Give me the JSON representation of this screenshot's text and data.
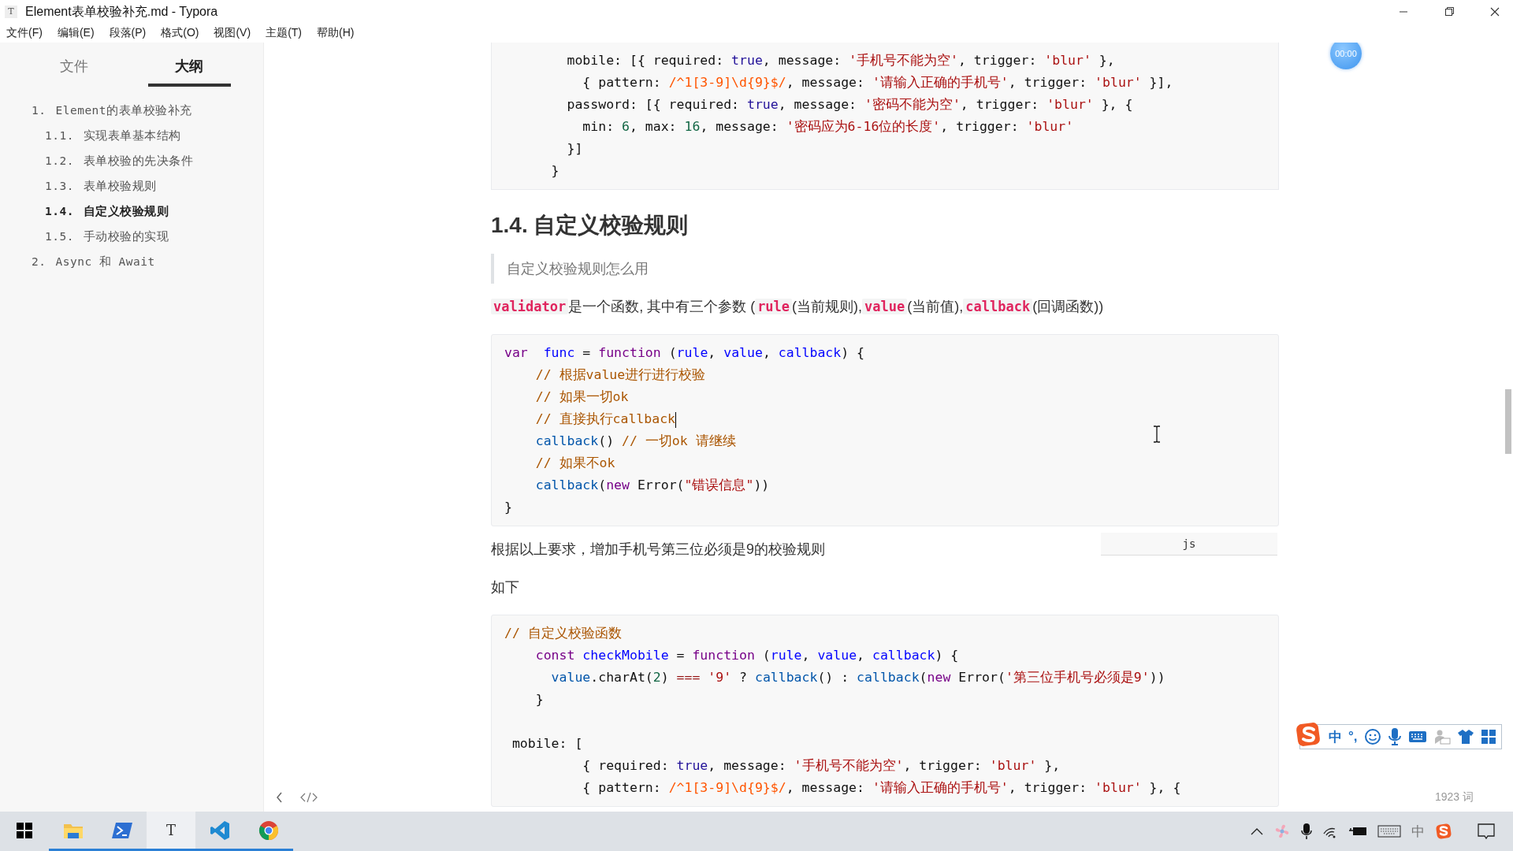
{
  "window": {
    "icon_letter": "T",
    "title": "Element表单校验补充.md - Typora"
  },
  "menu": [
    "文件(F)",
    "编辑(E)",
    "段落(P)",
    "格式(O)",
    "视图(V)",
    "主题(T)",
    "帮助(H)"
  ],
  "sidebar": {
    "tabs": [
      {
        "label": "文件",
        "selected": false
      },
      {
        "label": "大纲",
        "selected": true
      }
    ],
    "outline": [
      {
        "number": "1.",
        "label": "Element的表单校验补充",
        "selected": false,
        "children": [
          {
            "number": "1.1.",
            "label": "实现表单基本结构",
            "selected": false
          },
          {
            "number": "1.2.",
            "label": "表单校验的先决条件",
            "selected": false
          },
          {
            "number": "1.3.",
            "label": "表单校验规则",
            "selected": false
          },
          {
            "number": "1.4.",
            "label": "自定义校验规则",
            "selected": true
          },
          {
            "number": "1.5.",
            "label": "手动校验的实现",
            "selected": false
          }
        ]
      },
      {
        "number": "2.",
        "label": "Async 和 Await",
        "selected": false
      }
    ]
  },
  "document": {
    "blocks": [
      {
        "kind": "code",
        "lines": [
          {
            "tokens": [
              {
                "kind": "plain",
                "text": "        mobile: [{ required: "
              },
              {
                "kind": "atom",
                "text": "true"
              },
              {
                "kind": "plain",
                "text": ", message: "
              },
              {
                "kind": "string",
                "text": "'手机号不能为空'"
              },
              {
                "kind": "plain",
                "text": ", trigger: "
              },
              {
                "kind": "string",
                "text": "'blur'"
              },
              {
                "kind": "plain",
                "text": " },"
              }
            ]
          },
          {
            "tokens": [
              {
                "kind": "plain",
                "text": "          { pattern: "
              },
              {
                "kind": "regex",
                "text": "/^1[3-9]\\d{9}$/"
              },
              {
                "kind": "plain",
                "text": ", message: "
              },
              {
                "kind": "string",
                "text": "'请输入正确的手机号'"
              },
              {
                "kind": "plain",
                "text": ", trigger: "
              },
              {
                "kind": "string",
                "text": "'blur'"
              },
              {
                "kind": "plain",
                "text": " }],"
              }
            ]
          },
          {
            "tokens": [
              {
                "kind": "plain",
                "text": "        password: [{ required: "
              },
              {
                "kind": "atom",
                "text": "true"
              },
              {
                "kind": "plain",
                "text": ", message: "
              },
              {
                "kind": "string",
                "text": "'密码不能为空'"
              },
              {
                "kind": "plain",
                "text": ", trigger: "
              },
              {
                "kind": "string",
                "text": "'blur'"
              },
              {
                "kind": "plain",
                "text": " }, {"
              }
            ]
          },
          {
            "tokens": [
              {
                "kind": "plain",
                "text": "          min: "
              },
              {
                "kind": "number",
                "text": "6"
              },
              {
                "kind": "plain",
                "text": ", max: "
              },
              {
                "kind": "number",
                "text": "16"
              },
              {
                "kind": "plain",
                "text": ", message: "
              },
              {
                "kind": "string",
                "text": "'密码应为6-16位的长度'"
              },
              {
                "kind": "plain",
                "text": ", trigger: "
              },
              {
                "kind": "string",
                "text": "'blur'"
              }
            ]
          },
          {
            "tokens": [
              {
                "kind": "plain",
                "text": "        }]"
              }
            ]
          },
          {
            "tokens": [
              {
                "kind": "plain",
                "text": "      }"
              }
            ]
          }
        ]
      },
      {
        "kind": "heading",
        "text": "1.4. 自定义校验规则"
      },
      {
        "kind": "quote",
        "text": "自定义校验规则怎么用"
      },
      {
        "kind": "paragraph",
        "parts": [
          {
            "kind": "code",
            "text": "validator"
          },
          {
            "kind": "text",
            "text": "是一个函数, 其中有三个参数 ("
          },
          {
            "kind": "code",
            "text": "rule"
          },
          {
            "kind": "text",
            "text": "(当前规则),"
          },
          {
            "kind": "code",
            "text": "value"
          },
          {
            "kind": "text",
            "text": "(当前值),"
          },
          {
            "kind": "code",
            "text": "callback"
          },
          {
            "kind": "text",
            "text": "(回调函数))"
          }
        ]
      },
      {
        "kind": "code",
        "language": "js",
        "lines": [
          {
            "caret": false,
            "tokens": [
              {
                "kind": "keyword",
                "text": "var  "
              },
              {
                "kind": "def",
                "text": "func"
              },
              {
                "kind": "plain",
                "text": " = "
              },
              {
                "kind": "keyword",
                "text": "function"
              },
              {
                "kind": "plain",
                "text": " ("
              },
              {
                "kind": "def",
                "text": "rule"
              },
              {
                "kind": "plain",
                "text": ", "
              },
              {
                "kind": "def",
                "text": "value"
              },
              {
                "kind": "plain",
                "text": ", "
              },
              {
                "kind": "def",
                "text": "callback"
              },
              {
                "kind": "plain",
                "text": ") {"
              }
            ]
          },
          {
            "caret": false,
            "tokens": [
              {
                "kind": "comment",
                "text": "    // 根据value进行进行校验"
              }
            ]
          },
          {
            "caret": false,
            "tokens": [
              {
                "kind": "comment",
                "text": "    // 如果一切ok"
              }
            ]
          },
          {
            "caret": true,
            "tokens": [
              {
                "kind": "comment",
                "text": "    // 直接执行callback"
              }
            ]
          },
          {
            "caret": false,
            "tokens": [
              {
                "kind": "variable",
                "text": "    callback"
              },
              {
                "kind": "plain",
                "text": "() "
              },
              {
                "kind": "comment",
                "text": "// 一切ok 请继续"
              }
            ]
          },
          {
            "caret": false,
            "tokens": [
              {
                "kind": "comment",
                "text": "    // 如果不ok"
              }
            ]
          },
          {
            "caret": false,
            "tokens": [
              {
                "kind": "variable",
                "text": "    callback"
              },
              {
                "kind": "plain",
                "text": "("
              },
              {
                "kind": "keyword",
                "text": "new"
              },
              {
                "kind": "plain",
                "text": " Error("
              },
              {
                "kind": "string",
                "text": "\"错误信息\""
              },
              {
                "kind": "plain",
                "text": "))"
              }
            ]
          },
          {
            "caret": false,
            "tokens": [
              {
                "kind": "plain",
                "text": "}"
              }
            ]
          }
        ]
      },
      {
        "kind": "paragraph",
        "parts": [
          {
            "kind": "text",
            "text": "根据以上要求，增加手机号第三位必须是9的校验规则"
          }
        ]
      },
      {
        "kind": "paragraph",
        "parts": [
          {
            "kind": "text",
            "text": "如下"
          }
        ]
      },
      {
        "kind": "code",
        "lines": [
          {
            "tokens": [
              {
                "kind": "comment",
                "text": "// 自定义校验函数"
              }
            ]
          },
          {
            "tokens": [
              {
                "kind": "keyword",
                "text": "    const "
              },
              {
                "kind": "def",
                "text": "checkMobile"
              },
              {
                "kind": "plain",
                "text": " = "
              },
              {
                "kind": "keyword",
                "text": "function"
              },
              {
                "kind": "plain",
                "text": " ("
              },
              {
                "kind": "def",
                "text": "rule"
              },
              {
                "kind": "plain",
                "text": ", "
              },
              {
                "kind": "def",
                "text": "value"
              },
              {
                "kind": "plain",
                "text": ", "
              },
              {
                "kind": "def",
                "text": "callback"
              },
              {
                "kind": "plain",
                "text": ") {"
              }
            ]
          },
          {
            "tokens": [
              {
                "kind": "variable",
                "text": "      value"
              },
              {
                "kind": "plain",
                "text": ".charAt("
              },
              {
                "kind": "number",
                "text": "2"
              },
              {
                "kind": "plain",
                "text": ") "
              },
              {
                "kind": "operator",
                "text": "=== "
              },
              {
                "kind": "string",
                "text": "'9'"
              },
              {
                "kind": "plain",
                "text": " ? "
              },
              {
                "kind": "variable",
                "text": "callback"
              },
              {
                "kind": "plain",
                "text": "() : "
              },
              {
                "kind": "variable",
                "text": "callback"
              },
              {
                "kind": "plain",
                "text": "("
              },
              {
                "kind": "keyword",
                "text": "new"
              },
              {
                "kind": "plain",
                "text": " Error("
              },
              {
                "kind": "string",
                "text": "'第三位手机号必须是9'"
              },
              {
                "kind": "plain",
                "text": "))"
              }
            ]
          },
          {
            "tokens": [
              {
                "kind": "plain",
                "text": "    }"
              }
            ]
          },
          {
            "kind": "blank"
          },
          {
            "tokens": [
              {
                "kind": "plain",
                "text": " mobile: ["
              }
            ]
          },
          {
            "tokens": [
              {
                "kind": "plain",
                "text": "          { required: "
              },
              {
                "kind": "atom",
                "text": "true"
              },
              {
                "kind": "plain",
                "text": ", message: "
              },
              {
                "kind": "string",
                "text": "'手机号不能为空'"
              },
              {
                "kind": "plain",
                "text": ", trigger: "
              },
              {
                "kind": "string",
                "text": "'blur'"
              },
              {
                "kind": "plain",
                "text": " },"
              }
            ]
          },
          {
            "tokens": [
              {
                "kind": "plain",
                "text": "          { pattern: "
              },
              {
                "kind": "regex",
                "text": "/^1[3-9]\\d{9}$/"
              },
              {
                "kind": "plain",
                "text": ", message: "
              },
              {
                "kind": "string",
                "text": "'请输入正确的手机号'"
              },
              {
                "kind": "plain",
                "text": ", trigger: "
              },
              {
                "kind": "string",
                "text": "'blur'"
              },
              {
                "kind": "plain",
                "text": " }, {"
              }
            ]
          }
        ]
      }
    ]
  },
  "timer": "00:00",
  "footer": {
    "word_count": "1923 词"
  },
  "ime_toolbar": {
    "mode": "中",
    "punctuation": "°,"
  },
  "taskbar": {
    "apps": [
      {
        "kind": "explorer",
        "running": true,
        "active": false
      },
      {
        "kind": "terminal",
        "running": true,
        "active": false
      },
      {
        "kind": "typora",
        "letter": "T",
        "running": true,
        "active": true
      },
      {
        "kind": "editor",
        "running": true,
        "active": false
      },
      {
        "kind": "browser",
        "running": true,
        "active": false
      }
    ],
    "ime_mode": "中"
  }
}
